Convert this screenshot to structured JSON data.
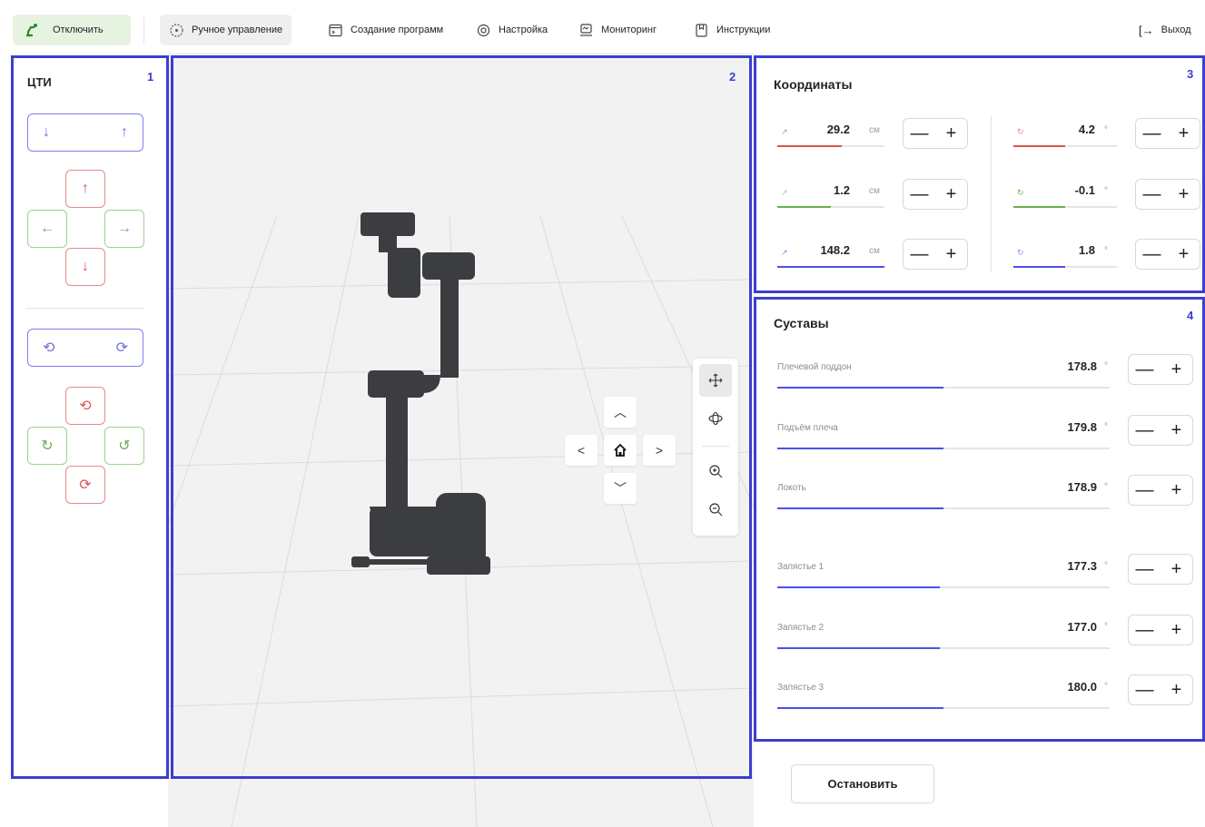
{
  "toolbar": {
    "disconnect_label": "Отключить",
    "nav": [
      {
        "label": "Ручное управление",
        "icon": "move-icon",
        "active": true
      },
      {
        "label": "Создание программ",
        "icon": "terminal-icon",
        "active": false
      },
      {
        "label": "Настройка",
        "icon": "settings-icon",
        "active": false
      },
      {
        "label": "Мониторинг",
        "icon": "monitor-icon",
        "active": false
      },
      {
        "label": "Инструкции",
        "icon": "book-icon",
        "active": false
      }
    ],
    "logout_label": "Выход"
  },
  "panels": {
    "p1_number": "1",
    "p2_number": "2",
    "p3_number": "3",
    "p4_number": "4"
  },
  "tcp_panel": {
    "title": "ЦТИ"
  },
  "coordinates": {
    "title": "Координаты",
    "linear": [
      {
        "axis": "x",
        "value": "29.2",
        "unit": "см",
        "color": "#d9534f",
        "level": 0.6
      },
      {
        "axis": "y",
        "value": "1.2",
        "unit": "см",
        "color": "#6bb04f",
        "level": 0.5
      },
      {
        "axis": "z",
        "value": "148.2",
        "unit": "см",
        "color": "#4b50e6",
        "level": 1.0
      }
    ],
    "rotation": [
      {
        "axis": "rx",
        "value": "4.2",
        "unit": "°",
        "color": "#d9534f",
        "level": 0.5
      },
      {
        "axis": "ry",
        "value": "-0.1",
        "unit": "°",
        "color": "#6bb04f",
        "level": 0.5
      },
      {
        "axis": "rz",
        "value": "1.8",
        "unit": "°",
        "color": "#4b50e6",
        "level": 0.5
      }
    ]
  },
  "joints": {
    "title": "Суставы",
    "items": [
      {
        "label": "Плечевой поддон",
        "value": "178.8",
        "unit": "°",
        "level": 0.5
      },
      {
        "label": "Подъём плеча",
        "value": "179.8",
        "unit": "°",
        "level": 0.5
      },
      {
        "label": "Локоть",
        "value": "178.9",
        "unit": "°",
        "level": 0.5
      },
      {
        "label": "Запястье 1",
        "value": "177.3",
        "unit": "°",
        "level": 0.49
      },
      {
        "label": "Запястье 2",
        "value": "177.0",
        "unit": "°",
        "level": 0.49
      },
      {
        "label": "Запястье 3",
        "value": "180.0",
        "unit": "°",
        "level": 0.5
      }
    ]
  },
  "stop_label": "Остановить",
  "stepper": {
    "minus": "—",
    "plus": "+"
  }
}
